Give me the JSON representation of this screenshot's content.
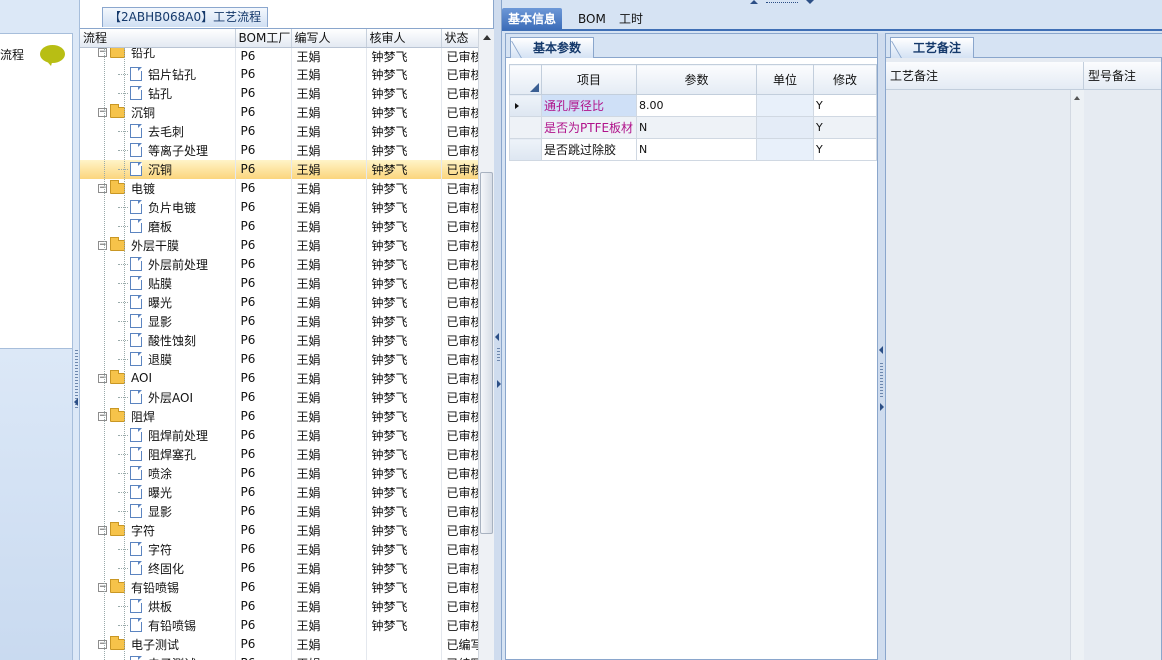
{
  "left_strip": {
    "title": "流程",
    "bubble_icon": "speech-bubble-icon",
    "bubble_color": "#b8be14"
  },
  "tree_panel": {
    "tab_title": "【2ABHB068A0】工艺流程",
    "columns": [
      "流程",
      "BOM工厂",
      "编写人",
      "核审人",
      "状态"
    ],
    "rows": [
      {
        "name": "铅孔",
        "level": 0,
        "type": "folder",
        "bom": "P6",
        "writer": "王娟",
        "reviewer": "钟梦飞",
        "status": "已审核",
        "clipped": true
      },
      {
        "name": "铝片钻孔",
        "level": 1,
        "type": "doc",
        "bom": "P6",
        "writer": "王娟",
        "reviewer": "钟梦飞",
        "status": "已审核"
      },
      {
        "name": "钻孔",
        "level": 1,
        "type": "doc",
        "bom": "P6",
        "writer": "王娟",
        "reviewer": "钟梦飞",
        "status": "已审核"
      },
      {
        "name": "沉铜",
        "level": 0,
        "type": "folder",
        "bom": "P6",
        "writer": "王娟",
        "reviewer": "钟梦飞",
        "status": "已审核"
      },
      {
        "name": "去毛刺",
        "level": 1,
        "type": "doc",
        "bom": "P6",
        "writer": "王娟",
        "reviewer": "钟梦飞",
        "status": "已审核"
      },
      {
        "name": "等离子处理",
        "level": 1,
        "type": "doc",
        "bom": "P6",
        "writer": "王娟",
        "reviewer": "钟梦飞",
        "status": "已审核"
      },
      {
        "name": "沉铜",
        "level": 1,
        "type": "doc",
        "bom": "P6",
        "writer": "王娟",
        "reviewer": "钟梦飞",
        "status": "已审核",
        "selected": true
      },
      {
        "name": "电镀",
        "level": 0,
        "type": "folder",
        "bom": "P6",
        "writer": "王娟",
        "reviewer": "钟梦飞",
        "status": "已审核"
      },
      {
        "name": "负片电镀",
        "level": 1,
        "type": "doc",
        "bom": "P6",
        "writer": "王娟",
        "reviewer": "钟梦飞",
        "status": "已审核"
      },
      {
        "name": "磨板",
        "level": 1,
        "type": "doc",
        "bom": "P6",
        "writer": "王娟",
        "reviewer": "钟梦飞",
        "status": "已审核"
      },
      {
        "name": "外层干膜",
        "level": 0,
        "type": "folder",
        "bom": "P6",
        "writer": "王娟",
        "reviewer": "钟梦飞",
        "status": "已审核"
      },
      {
        "name": "外层前处理",
        "level": 1,
        "type": "doc",
        "bom": "P6",
        "writer": "王娟",
        "reviewer": "钟梦飞",
        "status": "已审核"
      },
      {
        "name": "贴膜",
        "level": 1,
        "type": "doc",
        "bom": "P6",
        "writer": "王娟",
        "reviewer": "钟梦飞",
        "status": "已审核"
      },
      {
        "name": "曝光",
        "level": 1,
        "type": "doc",
        "bom": "P6",
        "writer": "王娟",
        "reviewer": "钟梦飞",
        "status": "已审核"
      },
      {
        "name": "显影",
        "level": 1,
        "type": "doc",
        "bom": "P6",
        "writer": "王娟",
        "reviewer": "钟梦飞",
        "status": "已审核"
      },
      {
        "name": "酸性蚀刻",
        "level": 1,
        "type": "doc",
        "bom": "P6",
        "writer": "王娟",
        "reviewer": "钟梦飞",
        "status": "已审核"
      },
      {
        "name": "退膜",
        "level": 1,
        "type": "doc",
        "bom": "P6",
        "writer": "王娟",
        "reviewer": "钟梦飞",
        "status": "已审核"
      },
      {
        "name": "AOI",
        "level": 0,
        "type": "folder",
        "bom": "P6",
        "writer": "王娟",
        "reviewer": "钟梦飞",
        "status": "已审核"
      },
      {
        "name": "外层AOI",
        "level": 1,
        "type": "doc",
        "bom": "P6",
        "writer": "王娟",
        "reviewer": "钟梦飞",
        "status": "已审核"
      },
      {
        "name": "阻焊",
        "level": 0,
        "type": "folder",
        "bom": "P6",
        "writer": "王娟",
        "reviewer": "钟梦飞",
        "status": "已审核"
      },
      {
        "name": "阻焊前处理",
        "level": 1,
        "type": "doc",
        "bom": "P6",
        "writer": "王娟",
        "reviewer": "钟梦飞",
        "status": "已审核"
      },
      {
        "name": "阻焊塞孔",
        "level": 1,
        "type": "doc",
        "bom": "P6",
        "writer": "王娟",
        "reviewer": "钟梦飞",
        "status": "已审核"
      },
      {
        "name": "喷涂",
        "level": 1,
        "type": "doc",
        "bom": "P6",
        "writer": "王娟",
        "reviewer": "钟梦飞",
        "status": "已审核"
      },
      {
        "name": "曝光",
        "level": 1,
        "type": "doc",
        "bom": "P6",
        "writer": "王娟",
        "reviewer": "钟梦飞",
        "status": "已审核"
      },
      {
        "name": "显影",
        "level": 1,
        "type": "doc",
        "bom": "P6",
        "writer": "王娟",
        "reviewer": "钟梦飞",
        "status": "已审核"
      },
      {
        "name": "字符",
        "level": 0,
        "type": "folder",
        "bom": "P6",
        "writer": "王娟",
        "reviewer": "钟梦飞",
        "status": "已审核"
      },
      {
        "name": "字符",
        "level": 1,
        "type": "doc",
        "bom": "P6",
        "writer": "王娟",
        "reviewer": "钟梦飞",
        "status": "已审核"
      },
      {
        "name": "终固化",
        "level": 1,
        "type": "doc",
        "bom": "P6",
        "writer": "王娟",
        "reviewer": "钟梦飞",
        "status": "已审核"
      },
      {
        "name": "有铅喷锡",
        "level": 0,
        "type": "folder",
        "bom": "P6",
        "writer": "王娟",
        "reviewer": "钟梦飞",
        "status": "已审核"
      },
      {
        "name": "烘板",
        "level": 1,
        "type": "doc",
        "bom": "P6",
        "writer": "王娟",
        "reviewer": "钟梦飞",
        "status": "已审核"
      },
      {
        "name": "有铅喷锡",
        "level": 1,
        "type": "doc",
        "bom": "P6",
        "writer": "王娟",
        "reviewer": "钟梦飞",
        "status": "已审核"
      },
      {
        "name": "电子测试",
        "level": 0,
        "type": "folder",
        "bom": "P6",
        "writer": "王娟",
        "reviewer": "",
        "status": "已编写"
      },
      {
        "name": "电子测试",
        "level": 1,
        "type": "doc",
        "bom": "P6",
        "writer": "王娟",
        "reviewer": "",
        "status": "已编写"
      }
    ]
  },
  "top_tabs": [
    {
      "label": "基本信息",
      "active": true
    },
    {
      "label": "BOM",
      "active": false
    },
    {
      "label": "工时",
      "active": false
    }
  ],
  "params_panel": {
    "tab_label": "基本参数",
    "columns": [
      "项目",
      "参数",
      "单位",
      "修改"
    ],
    "rows": [
      {
        "item": "通孔厚径比",
        "value": "8.00",
        "unit": "",
        "modify": "Y",
        "pink": true,
        "current": true
      },
      {
        "item": "是否为PTFE板材",
        "value": "N",
        "unit": "",
        "modify": "Y",
        "pink": true,
        "current": false
      },
      {
        "item": "是否跳过除胶",
        "value": "N",
        "unit": "",
        "modify": "Y",
        "pink": false,
        "current": false
      }
    ]
  },
  "notes_panel": {
    "tab_label": "工艺备注",
    "columns": [
      "工艺备注",
      "型号备注"
    ]
  }
}
